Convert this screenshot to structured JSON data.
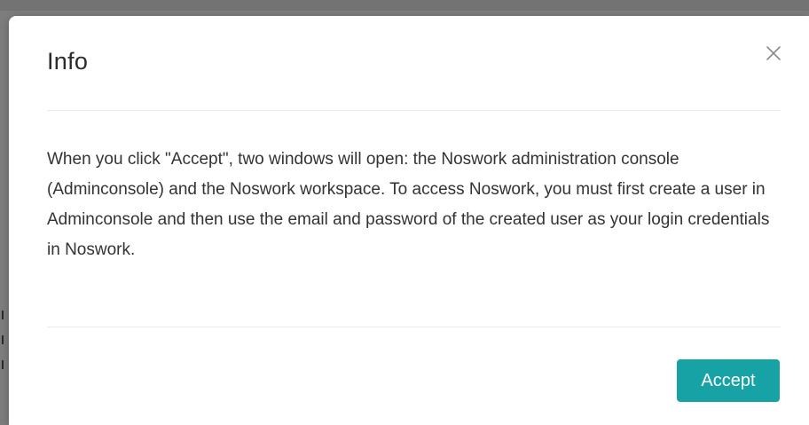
{
  "dialog": {
    "title": "Info",
    "body": "When you click \"Accept\", two windows will open: the Noswork administration console (Adminconsole) and the Noswork workspace. To access Noswork, you must first create a user in Adminconsole and then use the email and password of the created user as your login credentials in Noswork.",
    "accept_label": "Accept",
    "close_icon": "close-icon"
  },
  "colors": {
    "accent": "#17a2a6",
    "backdrop": "#7d7d7d",
    "text": "#333333"
  }
}
